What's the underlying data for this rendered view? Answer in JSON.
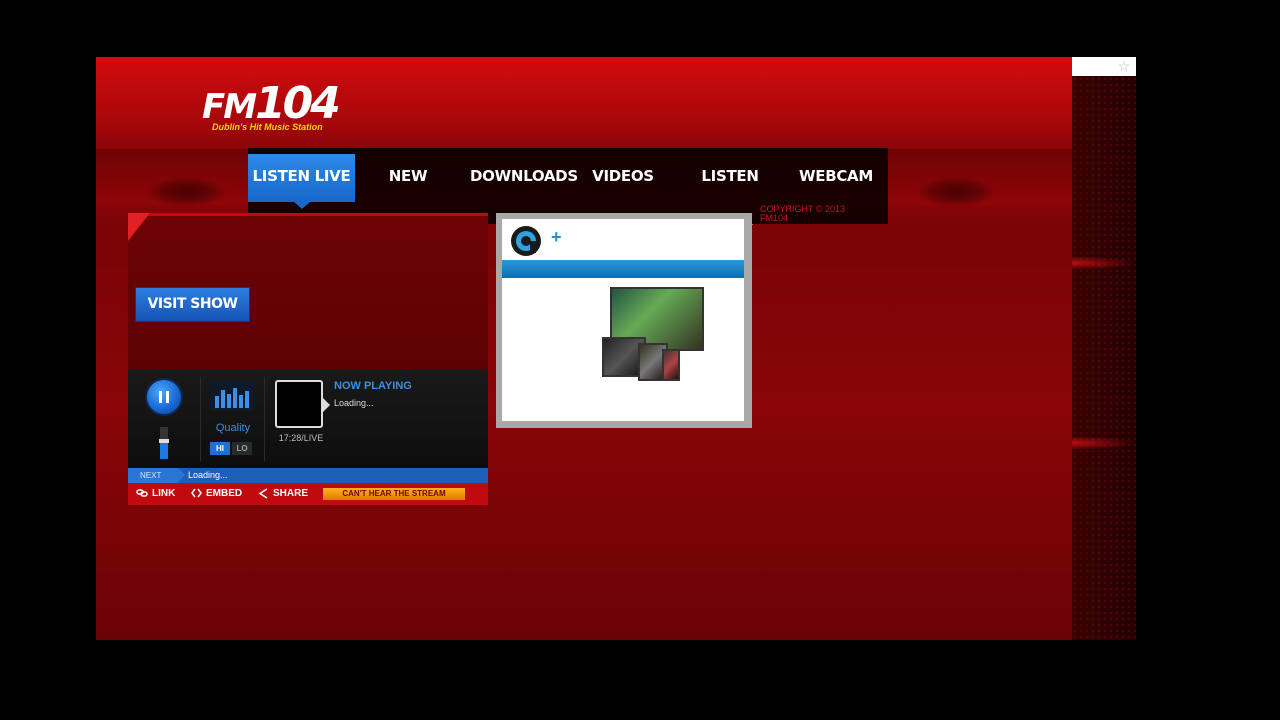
{
  "brand": {
    "logo_text_fm": "FM",
    "logo_text_num": "104",
    "tagline": "Dublin's Hit Music Station",
    "copyright": "COPYRIGHT © 2013 FM104"
  },
  "nav": {
    "items": [
      {
        "label": "LISTEN LIVE",
        "active": true
      },
      {
        "label": "NEW MUSIC",
        "active": false
      },
      {
        "label": "DOWNLOADS",
        "active": false
      },
      {
        "label": "VIDEOS",
        "active": false
      },
      {
        "label": "LISTEN BACK",
        "active": false
      },
      {
        "label": "WEBCAM",
        "active": false
      }
    ]
  },
  "player": {
    "visit_show_label": "VISIT SHOW",
    "quality_label": "Quality",
    "quality_hi": "HI",
    "quality_lo": "LO",
    "now_playing_label": "NOW PLAYING",
    "now_playing_value": "Loading...",
    "time": "17:28/LIVE",
    "volume_level": 0.55,
    "next_label": "NEXT",
    "next_value": "Loading..."
  },
  "share_bar": {
    "link_label": "LINK",
    "embed_label": "EMBED",
    "share_label": "SHARE",
    "cant_hear_label": "CAN'T HEAR THE STREAM"
  },
  "ad": {
    "plus": "+"
  },
  "colors": {
    "brand_red": "#c4080c",
    "accent_blue": "#1f7ae0",
    "tagline_yellow": "#ffd400",
    "cta_orange": "#ffb21c"
  },
  "icons": [
    "star-icon",
    "pause-icon",
    "equalizer-icon",
    "link-icon",
    "embed-icon",
    "share-icon"
  ]
}
